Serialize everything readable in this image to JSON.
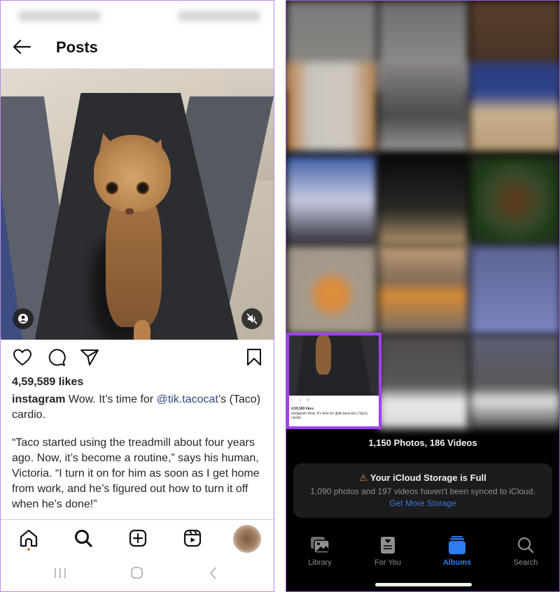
{
  "instagram": {
    "header": {
      "title": "Posts",
      "back_icon": "arrow-left-icon"
    },
    "media": {
      "subject": "cat on treadmill",
      "user_tag_icon": "user-tag-icon",
      "mute_icon": "sound-off-icon"
    },
    "actions": {
      "like_icon": "heart-icon",
      "comment_icon": "comment-icon",
      "share_icon": "send-icon",
      "save_icon": "bookmark-icon"
    },
    "likes": "4,59,589 likes",
    "caption": {
      "username": "instagram",
      "text_before": " Wow. It’s time for ",
      "mention": "@tik.tacocat",
      "text_after": "’s (Taco) cardio.",
      "body": "“Taco started using the treadmill about four years ago. Now, it’s become a routine,” says his human, Victoria. “I turn it on for him as soon as I get home from work, and he’s figured out how to turn it off when he’s done!”"
    },
    "bottom_nav": [
      "home-icon",
      "search-icon",
      "create-icon",
      "reels-icon",
      "profile-avatar"
    ],
    "accent_dot_color": "#d07a3c"
  },
  "photos": {
    "highlighted_thumbnail": {
      "likes": "4,59,589 likes",
      "caption": "instagram Wow. It's time for @tik.tacocat's (Taco) cardio.",
      "highlight_color": "#a040f0"
    },
    "counts": "1,150 Photos, 186 Videos",
    "icloud": {
      "warning_icon": "warning-icon",
      "title": "Your iCloud Storage is Full",
      "subtitle": "1,090 photos and 197 videos haven't been synced to iCloud.",
      "link": "Get More Storage",
      "link_color": "#3a78d6"
    },
    "tabs": [
      {
        "label": "Library",
        "icon": "photo-library-icon",
        "active": false
      },
      {
        "label": "For You",
        "icon": "for-you-icon",
        "active": false
      },
      {
        "label": "Albums",
        "icon": "albums-icon",
        "active": true
      },
      {
        "label": "Search",
        "icon": "search-icon",
        "active": false
      }
    ],
    "active_color": "#2d7ef0"
  }
}
